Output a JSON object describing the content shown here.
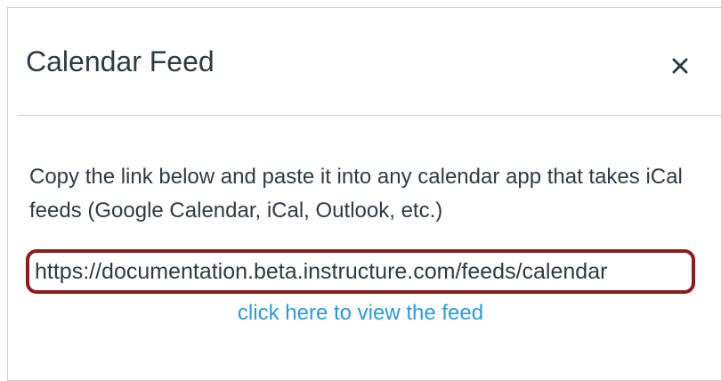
{
  "dialog": {
    "title": "Calendar Feed",
    "close_icon": "close-icon"
  },
  "body": {
    "instructions": "Copy the link below and paste it into any calendar app that takes iCal feeds (Google Calendar, iCal, Outlook, etc.)",
    "feed_url": "https://documentation.beta.instructure.com/feeds/calendar",
    "view_feed_link": "click here to view the feed"
  },
  "colors": {
    "title_text": "#2d3b45",
    "link": "#2a9bdc",
    "highlight_border": "#8b1c1c",
    "divider": "#c7cdd1"
  }
}
